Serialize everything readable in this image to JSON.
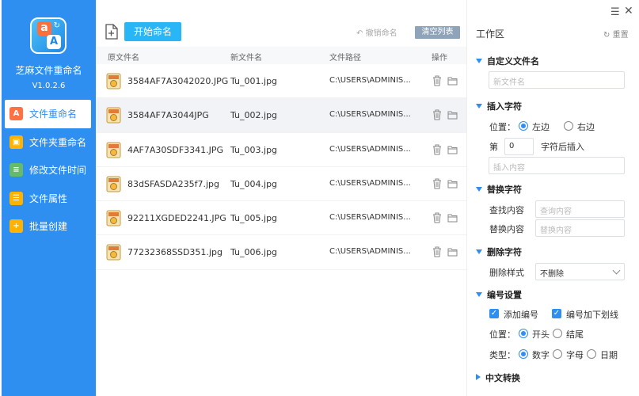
{
  "app": {
    "name": "芝麻文件重命名",
    "version": "V1.0.2.6"
  },
  "nav": [
    {
      "label": "文件重命名",
      "icon": "file-rename-icon",
      "color": "#ff7043"
    },
    {
      "label": "文件夹重命名",
      "icon": "folder-rename-icon",
      "color": "#ffb300"
    },
    {
      "label": "修改文件时间",
      "icon": "file-time-icon",
      "color": "#66bb6a"
    },
    {
      "label": "文件属性",
      "icon": "file-attr-icon",
      "color": "#ffb300"
    },
    {
      "label": "批量创建",
      "icon": "batch-create-icon",
      "color": "#ffb300"
    }
  ],
  "toolbar": {
    "start_label": "开始命名",
    "undo_label": "撤销命名",
    "clear_label": "清空列表"
  },
  "table": {
    "headers": {
      "orig": "原文件名",
      "new": "新文件名",
      "path": "文件路径",
      "ops": "操作"
    },
    "rows": [
      {
        "orig": "3584AF7A3042020.JPG",
        "new": "Tu_001.jpg",
        "path": "C:\\USERS\\ADMINIS..."
      },
      {
        "orig": "3584AF7A3044JPG",
        "new": "Tu_002.jpg",
        "path": "C:\\USERS\\ADMINIS..."
      },
      {
        "orig": "4AF7A30SDF3341.JPG",
        "new": "Tu_003.jpg",
        "path": "C:\\USERS\\ADMINIS..."
      },
      {
        "orig": "83dSFASDA235f7.jpg",
        "new": "Tu_004.jpg",
        "path": "C:\\USERS\\ADMINIS..."
      },
      {
        "orig": "92211XGDED2241.JPG",
        "new": "Tu_005.jpg",
        "path": "C:\\USERS\\ADMINIS..."
      },
      {
        "orig": "77232368SSD351.jpg",
        "new": "Tu_006.jpg",
        "path": "C:\\USERS\\ADMINIS..."
      }
    ]
  },
  "panel": {
    "title": "工作区",
    "reset_label": "重置",
    "custom": {
      "title": "自定义文件名",
      "placeholder": "新文件名"
    },
    "insert": {
      "title": "插入字符",
      "position_label": "位置：",
      "left": "左边",
      "right": "右边",
      "nth_label": "第",
      "nth_value": "0",
      "after_label": "字符后插入",
      "content_placeholder": "插入内容"
    },
    "replace": {
      "title": "替换字符",
      "find_label": "查找内容",
      "find_placeholder": "查询内容",
      "replace_label": "替换内容",
      "replace_placeholder": "替换内容"
    },
    "delete": {
      "title": "删除字符",
      "style_label": "删除样式",
      "style_value": "不删除"
    },
    "number": {
      "title": "编号设置",
      "add_label": "添加编号",
      "underline_label": "编号加下划线",
      "position_label": "位置：",
      "start": "开头",
      "end": "结尾",
      "type_label": "类型：",
      "digit": "数字",
      "letter": "字母",
      "date": "日期"
    },
    "chinese": {
      "title": "中文转换"
    }
  }
}
